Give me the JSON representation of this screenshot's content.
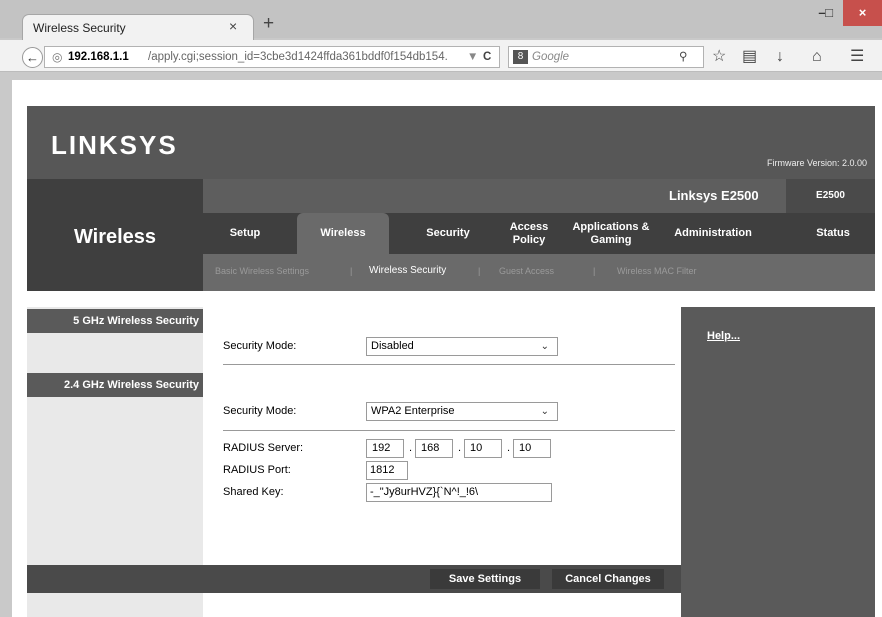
{
  "browser": {
    "tab_title": "Wireless Security",
    "tab_close": "×",
    "new_tab": "+",
    "window_controls": {
      "minimize": "–",
      "maximize": "□",
      "close": "×"
    },
    "back_icon": "back-arrow-icon",
    "url_host": "192.168.1.1",
    "url_rest": "/apply.cgi;session_id=3cbe3d1424ffda361bddf0f154db154.",
    "reload": "C",
    "search_engine_glyph": "8",
    "search_placeholder": "Google",
    "search_icon": "search-icon",
    "toolbar_icons": [
      "star-icon",
      "reading-list-icon",
      "download-icon",
      "home-icon",
      "menu-icon"
    ]
  },
  "router": {
    "brand": "LINKSYS",
    "firmware": "Firmware Version: 2.0.00",
    "section_title": "Wireless",
    "model_name": "Linksys E2500",
    "model_code": "E2500",
    "menu": [
      {
        "label": "Setup"
      },
      {
        "label": "Wireless",
        "active": true
      },
      {
        "label": "Security"
      },
      {
        "label": "Access Policy"
      },
      {
        "label": "Applications & Gaming"
      },
      {
        "label": "Administration"
      },
      {
        "label": "Status"
      }
    ],
    "submenu": [
      {
        "label": "Basic Wireless Settings"
      },
      {
        "label": "Wireless Security",
        "active": true
      },
      {
        "label": "Guest Access"
      },
      {
        "label": "Wireless MAC Filter"
      }
    ],
    "submenu_separator": "|"
  },
  "left_labels": {
    "ghz5": "5 GHz Wireless Security",
    "ghz24": "2.4 GHz Wireless Security"
  },
  "ghz5": {
    "security_mode_label": "Security Mode:",
    "security_mode_value": "Disabled"
  },
  "ghz24": {
    "security_mode_label": "Security Mode:",
    "security_mode_value": "WPA2 Enterprise",
    "radius_server_label": "RADIUS Server:",
    "radius_server": [
      "192",
      "168",
      "10",
      "10"
    ],
    "radius_port_label": "RADIUS Port:",
    "radius_port": "1812",
    "shared_key_label": "Shared Key:",
    "shared_key": "-_\"Jy8urHVZ}{`N^!_!6\\"
  },
  "help_label": "Help...",
  "footer": {
    "save_label": "Save Settings",
    "cancel_label": "Cancel Changes"
  },
  "colors": {
    "header_gray": "#575757",
    "band_dark": "#3f3f3f",
    "active_tab": "#6a6a6a",
    "close_button": "#c7504c"
  }
}
